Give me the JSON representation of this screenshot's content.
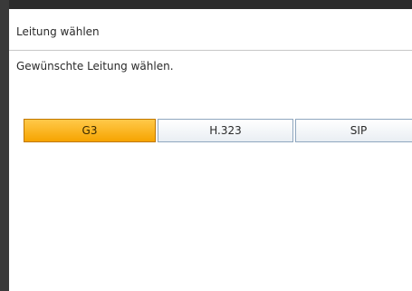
{
  "dialog": {
    "title": "Leitung wählen",
    "instruction": "Gewünschte Leitung wählen."
  },
  "options": [
    {
      "label": "G3",
      "selected": true
    },
    {
      "label": "H.323",
      "selected": false
    },
    {
      "label": "SIP",
      "selected": false
    }
  ],
  "colors": {
    "selected_fill": "#f6a400",
    "button_border": "#8fa7bf",
    "frame": "#2b2b2b"
  }
}
